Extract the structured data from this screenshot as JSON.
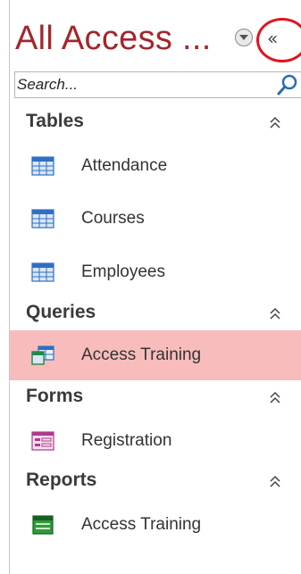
{
  "nav_pane": {
    "title": "All Access ...",
    "search": {
      "placeholder": "Search..."
    },
    "groups": [
      {
        "label": "Tables",
        "items": [
          {
            "label": "Attendance",
            "icon": "table-icon"
          },
          {
            "label": "Courses",
            "icon": "table-icon"
          },
          {
            "label": "Employees",
            "icon": "table-icon"
          }
        ]
      },
      {
        "label": "Queries",
        "items": [
          {
            "label": "Access Training",
            "icon": "query-icon",
            "selected": true
          }
        ]
      },
      {
        "label": "Forms",
        "items": [
          {
            "label": "Registration",
            "icon": "form-icon"
          }
        ]
      },
      {
        "label": "Reports",
        "items": [
          {
            "label": "Access Training",
            "icon": "report-icon"
          }
        ]
      }
    ],
    "collapse_glyph": "«",
    "colors": {
      "title": "#a4262c",
      "highlight_circle": "#e0141e",
      "selected_bg": "#f8bcbc"
    }
  }
}
